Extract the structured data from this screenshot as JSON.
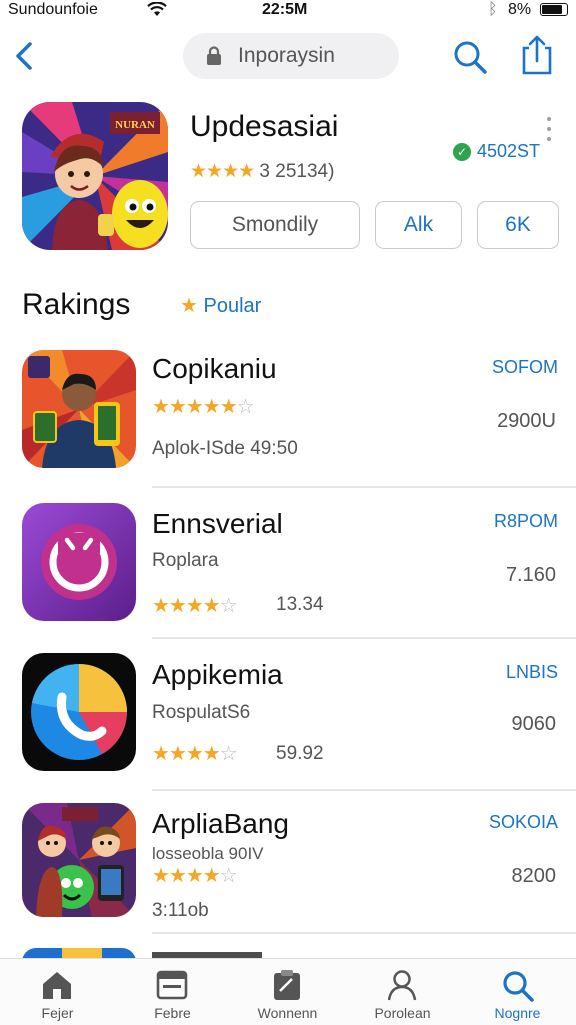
{
  "status_bar": {
    "carrier": "Sundounfoie",
    "time": "22:5M",
    "battery": "8%",
    "battery_level": 0.85
  },
  "nav": {
    "search_text": "Inporaysin"
  },
  "hero": {
    "title": "Updesasiai",
    "stars": "★★★★",
    "rating_text": "3 25134)",
    "badge_text": "4502ST",
    "buttons": [
      "Smondily",
      "Alk",
      "6K"
    ],
    "icon_banner": "NURAN"
  },
  "section": {
    "title": "Rakings",
    "tag_label": "Poular"
  },
  "apps": [
    {
      "name": "Copikaniu",
      "stars": "★★★★★",
      "count": "Aplok-ISde  49:50",
      "tag": "SOFOM",
      "price": "2900U",
      "accent": "#e6552b"
    },
    {
      "name": "Ennsverial",
      "subtitle": "Roplara",
      "stars": "★★★★",
      "empty_star": "☆",
      "count": "13.34",
      "tag": "R8POM",
      "price": "7.160",
      "accent": "#8e3fb7"
    },
    {
      "name": "Appikemia",
      "subtitle": "RospulatS6",
      "stars": "★★★★",
      "empty_star": "☆",
      "count": "59.92",
      "tag": "LNBIS",
      "price": "9060",
      "accent": "#1e88e5"
    },
    {
      "name": "ArpliaBang",
      "subtitle": "losseobla 90IV",
      "stars": "★★★★",
      "empty_star": "☆",
      "count": "3:11ob",
      "tag": "SOKOIA",
      "price": "8200",
      "accent": "#6a2f7c"
    }
  ],
  "tabs": [
    {
      "label": "Fejer",
      "icon": "home-icon"
    },
    {
      "label": "Febre",
      "icon": "browser-icon"
    },
    {
      "label": "Wonnenn",
      "icon": "clipboard-icon"
    },
    {
      "label": "Porolean",
      "icon": "person-icon"
    },
    {
      "label": "Nognre",
      "icon": "search-icon",
      "active": true
    }
  ],
  "colors": {
    "accent": "#1b74c5",
    "star": "#f5a623",
    "badge_green": "#2ea44f"
  }
}
